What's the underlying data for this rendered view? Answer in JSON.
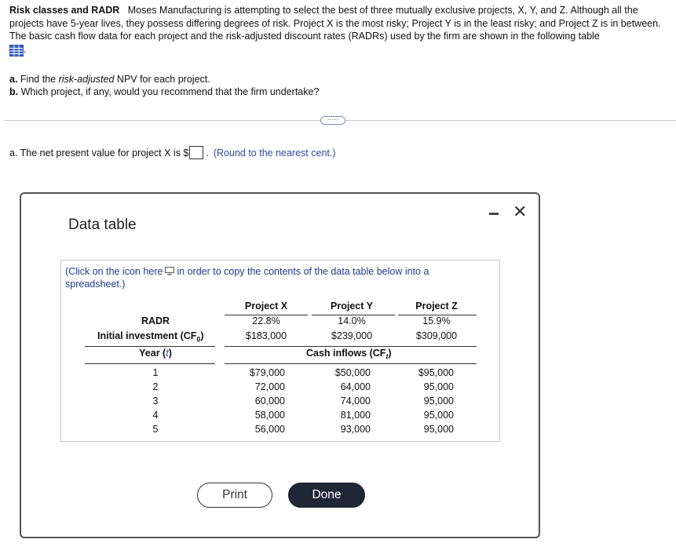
{
  "problem": {
    "title": "Risk classes and RADR",
    "text": "Moses Manufacturing is attempting to select the best of three mutually exclusive projects, X, Y, and Z. Although all the projects have 5-year lives, they possess differing degrees of risk. Project X is the most risky; Project Y is in the least risky; and Project Z is in between. The basic cash flow data for each project and the risk-adjusted discount rates (RADRs) used by the firm are shown in the following table",
    "table_icon": "table-grid-icon"
  },
  "parts": {
    "a_label": "a.",
    "a_text_pre": "Find the ",
    "a_text_italic": "risk-adjusted",
    "a_text_post": " NPV for each project.",
    "b_label": "b.",
    "b_text": "Which project, if any, would you recommend that the firm undertake?"
  },
  "expand_button": "·····",
  "answer": {
    "prompt": "a. The net present value for project X is $",
    "value": "",
    "hint": "(Round to the nearest cent.)"
  },
  "modal": {
    "title": "Data table",
    "copy_note_pre": "(Click on the icon here",
    "copy_note_post": "in order to copy the contents of the data table below into a spreadsheet.)",
    "table": {
      "projects": [
        "Project X",
        "Project Y",
        "Project Z"
      ],
      "radr_label": "RADR",
      "radr": [
        "22.8%",
        "14.0%",
        "15.9%"
      ],
      "investment_label": "Initial investment (CF",
      "investment_sub": "0",
      "investment_close": ")",
      "investment": [
        "$183,000",
        "$239,000",
        "$309,000"
      ],
      "year_label": "Year (",
      "year_var": "t",
      "year_close": ")",
      "cash_inflows_label": "Cash inflows (CF",
      "cash_inflows_sub": "t",
      "cash_inflows_close": ")",
      "years": [
        "1",
        "2",
        "3",
        "4",
        "5"
      ],
      "x_flows": [
        "$79,000",
        "72,000",
        "60,000",
        "58,000",
        "56,000"
      ],
      "y_flows": [
        "$50,000",
        "64,000",
        "74,000",
        "81,000",
        "93,000"
      ],
      "z_flows": [
        "$95,000",
        "95,000",
        "95,000",
        "95,000",
        "95,000"
      ]
    },
    "print_label": "Print",
    "done_label": "Done"
  }
}
